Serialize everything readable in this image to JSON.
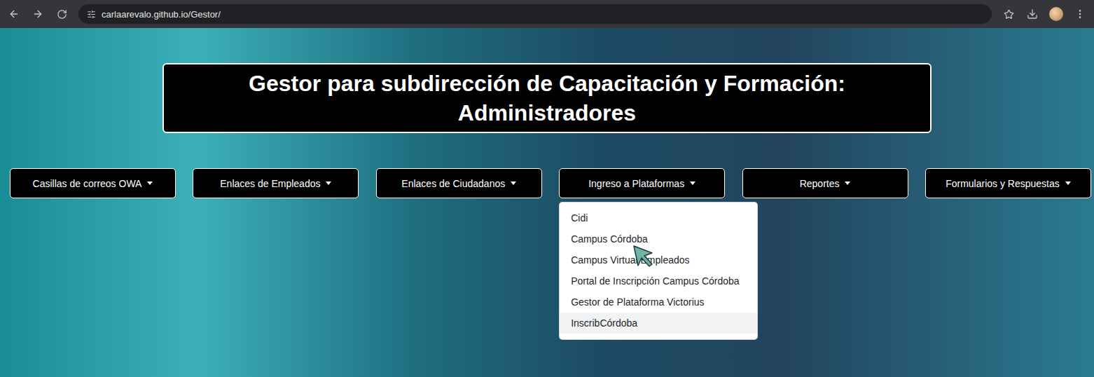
{
  "browser": {
    "url": "carlaarevalo.github.io/Gestor/"
  },
  "header": {
    "title": "Gestor para subdirección de Capacitación y Formación: Administradores"
  },
  "nav": [
    {
      "label": "Casillas de correos OWA",
      "expanded": false,
      "items": []
    },
    {
      "label": "Enlaces de Empleados",
      "expanded": false,
      "items": []
    },
    {
      "label": "Enlaces de Ciudadanos",
      "expanded": false,
      "items": []
    },
    {
      "label": "Ingreso a Plataformas",
      "expanded": true,
      "items": [
        {
          "label": "Cidi",
          "highlighted": false
        },
        {
          "label": "Campus Córdoba",
          "highlighted": false
        },
        {
          "label": "Campus Virtual Empleados",
          "highlighted": false
        },
        {
          "label": "Portal de Inscripción Campus Córdoba",
          "highlighted": false
        },
        {
          "label": "Gestor de Plataforma Victorius",
          "highlighted": false
        },
        {
          "label": "InscribCórdoba",
          "highlighted": true
        }
      ]
    },
    {
      "label": "Reportes",
      "expanded": false,
      "items": []
    },
    {
      "label": "Formularios y Respuestas",
      "expanded": false,
      "items": []
    }
  ]
}
